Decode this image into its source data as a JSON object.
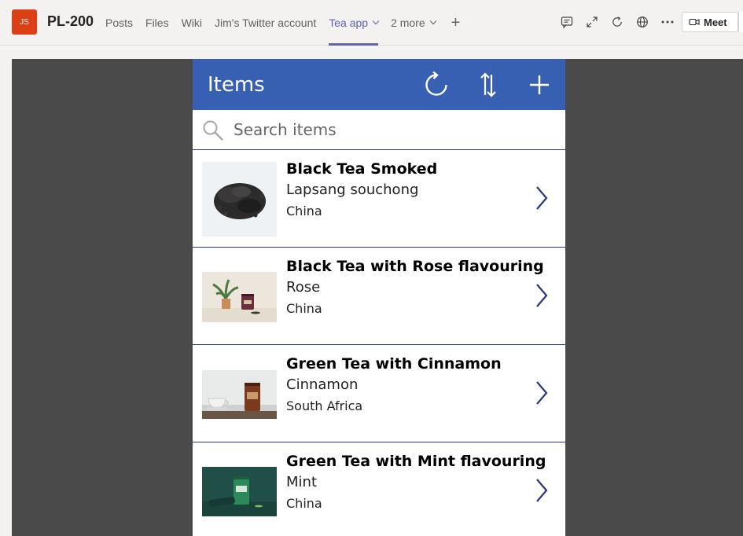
{
  "teams": {
    "avatar_initials": "JS",
    "team_name": "PL-200",
    "tabs": [
      {
        "label": "Posts"
      },
      {
        "label": "Files"
      },
      {
        "label": "Wiki"
      },
      {
        "label": "Jim's Twitter account"
      },
      {
        "label": "Tea app"
      },
      {
        "label": "2 more"
      }
    ],
    "meet_label": "Meet",
    "accent_color": "#6264a7"
  },
  "app": {
    "title": "Items",
    "header_color": "#3860b2",
    "search": {
      "placeholder": "Search items",
      "value": ""
    },
    "items": [
      {
        "title": "Black Tea Smoked",
        "subtitle": "Lapsang souchong",
        "origin": "China",
        "image": "loose-tea-leaves"
      },
      {
        "title": "Black Tea with Rose flavouring",
        "subtitle": "Rose",
        "origin": "China",
        "image": "plant-and-tea-tin"
      },
      {
        "title": "Green Tea with Cinnamon",
        "subtitle": "Cinnamon",
        "origin": "South Africa",
        "image": "cup-and-tea-tin"
      },
      {
        "title": "Green Tea with Mint flavouring",
        "subtitle": "Mint",
        "origin": "China",
        "image": "green-tea-tin"
      }
    ]
  }
}
